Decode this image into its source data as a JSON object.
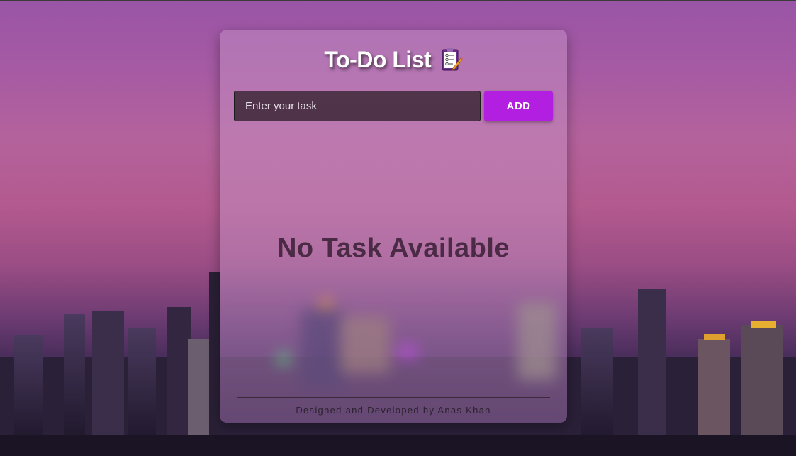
{
  "app": {
    "title": "To-Do List",
    "title_icon": "clipboard-checklist-icon"
  },
  "task_form": {
    "input_value": "",
    "input_placeholder": "Enter your task",
    "add_label": "ADD",
    "accent_color": "#b21fe0"
  },
  "task_list": {
    "items": [],
    "empty_message": "No Task Available"
  },
  "footer": {
    "credit": "Designed and Developed by Anas Khan"
  }
}
